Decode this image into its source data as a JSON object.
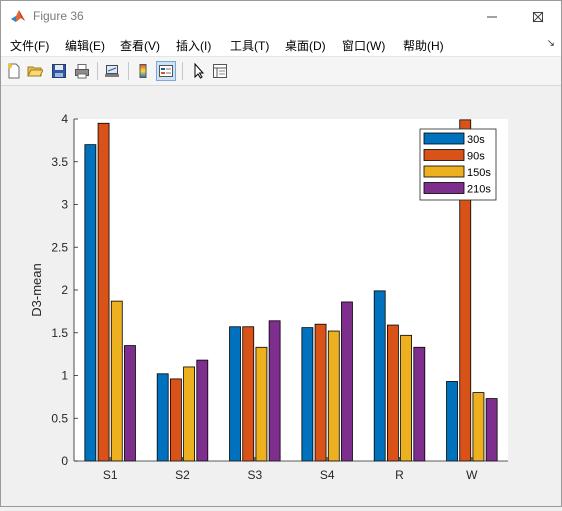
{
  "window": {
    "title": "Figure 36",
    "controls": [
      "minimize",
      "maximize",
      "close"
    ]
  },
  "menu": {
    "items": [
      "文件(F)",
      "编辑(E)",
      "查看(V)",
      "插入(I)",
      "工具(T)",
      "桌面(D)",
      "窗口(W)",
      "帮助(H)"
    ]
  },
  "toolbar": {
    "icons": [
      "new-figure-icon",
      "open-file-icon",
      "save-icon",
      "print-icon",
      "link-plot-icon",
      "colorbar-icon",
      "legend-icon",
      "pointer-icon",
      "property-inspector-icon"
    ]
  },
  "colors": {
    "series": [
      "#0072bd",
      "#d95319",
      "#edb120",
      "#7e2f8e"
    ]
  },
  "chart_data": {
    "type": "bar",
    "categories": [
      "S1",
      "S2",
      "S3",
      "S4",
      "R",
      "W"
    ],
    "series": [
      {
        "name": "30s",
        "values": [
          3.7,
          1.02,
          1.57,
          1.56,
          1.99,
          0.93
        ]
      },
      {
        "name": "90s",
        "values": [
          3.95,
          0.96,
          1.57,
          1.6,
          1.59,
          3.99
        ]
      },
      {
        "name": "150s",
        "values": [
          1.87,
          1.1,
          1.33,
          1.52,
          1.47,
          0.8
        ]
      },
      {
        "name": "210s",
        "values": [
          1.35,
          1.18,
          1.64,
          1.86,
          1.33,
          0.73
        ]
      }
    ],
    "title": "",
    "xlabel": "",
    "ylabel": "D3-mean",
    "ylim": [
      0,
      4
    ],
    "yticks": [
      "0",
      "0.5",
      "1",
      "1.5",
      "2",
      "2.5",
      "3",
      "3.5",
      "4"
    ],
    "grid": false,
    "legend": "top-right"
  }
}
